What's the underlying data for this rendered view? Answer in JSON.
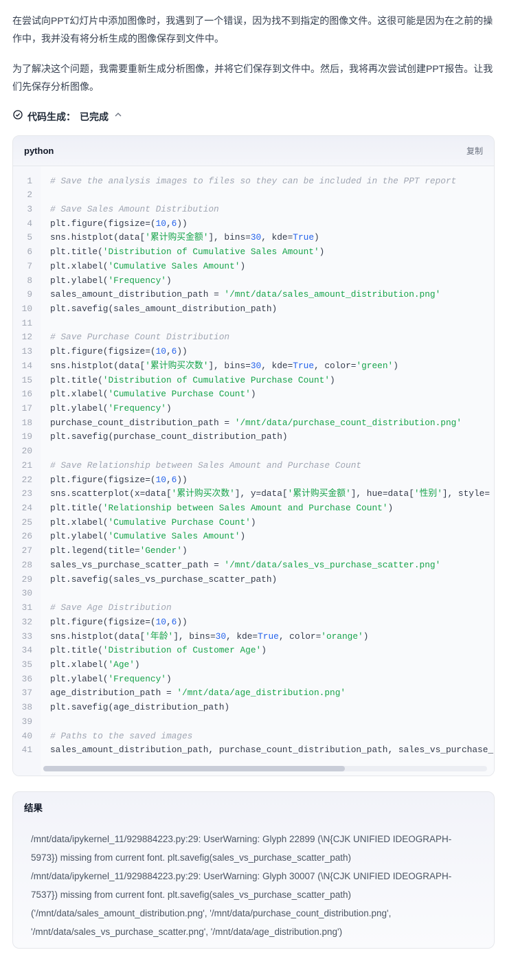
{
  "intro": {
    "p1": "在尝试向PPT幻灯片中添加图像时，我遇到了一个错误，因为找不到指定的图像文件。这很可能是因为在之前的操作中，我并没有将分析生成的图像保存到文件中。",
    "p2": "为了解决这个问题，我需要重新生成分析图像，并将它们保存到文件中。然后，我将再次尝试创建PPT报告。让我们先保存分析图像。"
  },
  "status": {
    "prefix": "代码生成：",
    "state": "已完成"
  },
  "code": {
    "lang": "python",
    "copy": "复制",
    "lines": [
      [
        [
          "co",
          "# Save the analysis images to files so they can be included in the PPT report"
        ]
      ],
      [],
      [
        [
          "co",
          "# Save Sales Amount Distribution"
        ]
      ],
      [
        [
          "id",
          "plt.figure(figsize"
        ],
        [
          "op",
          "=("
        ],
        [
          "nu",
          "10"
        ],
        [
          "op",
          ","
        ],
        [
          "nu",
          "6"
        ],
        [
          "op",
          "))"
        ]
      ],
      [
        [
          "id",
          "sns.histplot(data["
        ],
        [
          "st",
          "'累计购买金额'"
        ],
        [
          "id",
          "], bins"
        ],
        [
          "op",
          "="
        ],
        [
          "nu",
          "30"
        ],
        [
          "id",
          ", kde"
        ],
        [
          "op",
          "="
        ],
        [
          "kw",
          "True"
        ],
        [
          "op",
          ")"
        ]
      ],
      [
        [
          "id",
          "plt.title("
        ],
        [
          "st",
          "'Distribution of Cumulative Sales Amount'"
        ],
        [
          "op",
          ")"
        ]
      ],
      [
        [
          "id",
          "plt.xlabel("
        ],
        [
          "st",
          "'Cumulative Sales Amount'"
        ],
        [
          "op",
          ")"
        ]
      ],
      [
        [
          "id",
          "plt.ylabel("
        ],
        [
          "st",
          "'Frequency'"
        ],
        [
          "op",
          ")"
        ]
      ],
      [
        [
          "id",
          "sales_amount_distribution_path "
        ],
        [
          "op",
          "= "
        ],
        [
          "st",
          "'/mnt/data/sales_amount_distribution.png'"
        ]
      ],
      [
        [
          "id",
          "plt.savefig(sales_amount_distribution_path)"
        ]
      ],
      [],
      [
        [
          "co",
          "# Save Purchase Count Distribution"
        ]
      ],
      [
        [
          "id",
          "plt.figure(figsize"
        ],
        [
          "op",
          "=("
        ],
        [
          "nu",
          "10"
        ],
        [
          "op",
          ","
        ],
        [
          "nu",
          "6"
        ],
        [
          "op",
          "))"
        ]
      ],
      [
        [
          "id",
          "sns.histplot(data["
        ],
        [
          "st",
          "'累计购买次数'"
        ],
        [
          "id",
          "], bins"
        ],
        [
          "op",
          "="
        ],
        [
          "nu",
          "30"
        ],
        [
          "id",
          ", kde"
        ],
        [
          "op",
          "="
        ],
        [
          "kw",
          "True"
        ],
        [
          "id",
          ", color"
        ],
        [
          "op",
          "="
        ],
        [
          "st",
          "'green'"
        ],
        [
          "op",
          ")"
        ]
      ],
      [
        [
          "id",
          "plt.title("
        ],
        [
          "st",
          "'Distribution of Cumulative Purchase Count'"
        ],
        [
          "op",
          ")"
        ]
      ],
      [
        [
          "id",
          "plt.xlabel("
        ],
        [
          "st",
          "'Cumulative Purchase Count'"
        ],
        [
          "op",
          ")"
        ]
      ],
      [
        [
          "id",
          "plt.ylabel("
        ],
        [
          "st",
          "'Frequency'"
        ],
        [
          "op",
          ")"
        ]
      ],
      [
        [
          "id",
          "purchase_count_distribution_path "
        ],
        [
          "op",
          "= "
        ],
        [
          "st",
          "'/mnt/data/purchase_count_distribution.png'"
        ]
      ],
      [
        [
          "id",
          "plt.savefig(purchase_count_distribution_path)"
        ]
      ],
      [],
      [
        [
          "co",
          "# Save Relationship between Sales Amount and Purchase Count"
        ]
      ],
      [
        [
          "id",
          "plt.figure(figsize"
        ],
        [
          "op",
          "=("
        ],
        [
          "nu",
          "10"
        ],
        [
          "op",
          ","
        ],
        [
          "nu",
          "6"
        ],
        [
          "op",
          "))"
        ]
      ],
      [
        [
          "id",
          "sns.scatterplot(x"
        ],
        [
          "op",
          "="
        ],
        [
          "id",
          "data["
        ],
        [
          "st",
          "'累计购买次数'"
        ],
        [
          "id",
          "], y"
        ],
        [
          "op",
          "="
        ],
        [
          "id",
          "data["
        ],
        [
          "st",
          "'累计购买金额'"
        ],
        [
          "id",
          "], hue"
        ],
        [
          "op",
          "="
        ],
        [
          "id",
          "data["
        ],
        [
          "st",
          "'性别'"
        ],
        [
          "id",
          "], style"
        ],
        [
          "op",
          "="
        ]
      ],
      [
        [
          "id",
          "plt.title("
        ],
        [
          "st",
          "'Relationship between Sales Amount and Purchase Count'"
        ],
        [
          "op",
          ")"
        ]
      ],
      [
        [
          "id",
          "plt.xlabel("
        ],
        [
          "st",
          "'Cumulative Purchase Count'"
        ],
        [
          "op",
          ")"
        ]
      ],
      [
        [
          "id",
          "plt.ylabel("
        ],
        [
          "st",
          "'Cumulative Sales Amount'"
        ],
        [
          "op",
          ")"
        ]
      ],
      [
        [
          "id",
          "plt.legend(title"
        ],
        [
          "op",
          "="
        ],
        [
          "st",
          "'Gender'"
        ],
        [
          "op",
          ")"
        ]
      ],
      [
        [
          "id",
          "sales_vs_purchase_scatter_path "
        ],
        [
          "op",
          "= "
        ],
        [
          "st",
          "'/mnt/data/sales_vs_purchase_scatter.png'"
        ]
      ],
      [
        [
          "id",
          "plt.savefig(sales_vs_purchase_scatter_path)"
        ]
      ],
      [],
      [
        [
          "co",
          "# Save Age Distribution"
        ]
      ],
      [
        [
          "id",
          "plt.figure(figsize"
        ],
        [
          "op",
          "=("
        ],
        [
          "nu",
          "10"
        ],
        [
          "op",
          ","
        ],
        [
          "nu",
          "6"
        ],
        [
          "op",
          "))"
        ]
      ],
      [
        [
          "id",
          "sns.histplot(data["
        ],
        [
          "st",
          "'年龄'"
        ],
        [
          "id",
          "], bins"
        ],
        [
          "op",
          "="
        ],
        [
          "nu",
          "30"
        ],
        [
          "id",
          ", kde"
        ],
        [
          "op",
          "="
        ],
        [
          "kw",
          "True"
        ],
        [
          "id",
          ", color"
        ],
        [
          "op",
          "="
        ],
        [
          "st",
          "'orange'"
        ],
        [
          "op",
          ")"
        ]
      ],
      [
        [
          "id",
          "plt.title("
        ],
        [
          "st",
          "'Distribution of Customer Age'"
        ],
        [
          "op",
          ")"
        ]
      ],
      [
        [
          "id",
          "plt.xlabel("
        ],
        [
          "st",
          "'Age'"
        ],
        [
          "op",
          ")"
        ]
      ],
      [
        [
          "id",
          "plt.ylabel("
        ],
        [
          "st",
          "'Frequency'"
        ],
        [
          "op",
          ")"
        ]
      ],
      [
        [
          "id",
          "age_distribution_path "
        ],
        [
          "op",
          "= "
        ],
        [
          "st",
          "'/mnt/data/age_distribution.png'"
        ]
      ],
      [
        [
          "id",
          "plt.savefig(age_distribution_path)"
        ]
      ],
      [],
      [
        [
          "co",
          "# Paths to the saved images"
        ]
      ],
      [
        [
          "id",
          "sales_amount_distribution_path, purchase_count_distribution_path, sales_vs_purchase_s"
        ]
      ]
    ]
  },
  "result": {
    "header": "结果",
    "body": "/mnt/data/ipykernel_11/929884223.py:29: UserWarning: Glyph 22899 (\\N{CJK UNIFIED IDEOGRAPH-5973}) missing from current font. plt.savefig(sales_vs_purchase_scatter_path) /mnt/data/ipykernel_11/929884223.py:29: UserWarning: Glyph 30007 (\\N{CJK UNIFIED IDEOGRAPH-7537}) missing from current font. plt.savefig(sales_vs_purchase_scatter_path) ('/mnt/data/sales_amount_distribution.png', '/mnt/data/purchase_count_distribution.png', '/mnt/data/sales_vs_purchase_scatter.png', '/mnt/data/age_distribution.png')"
  }
}
